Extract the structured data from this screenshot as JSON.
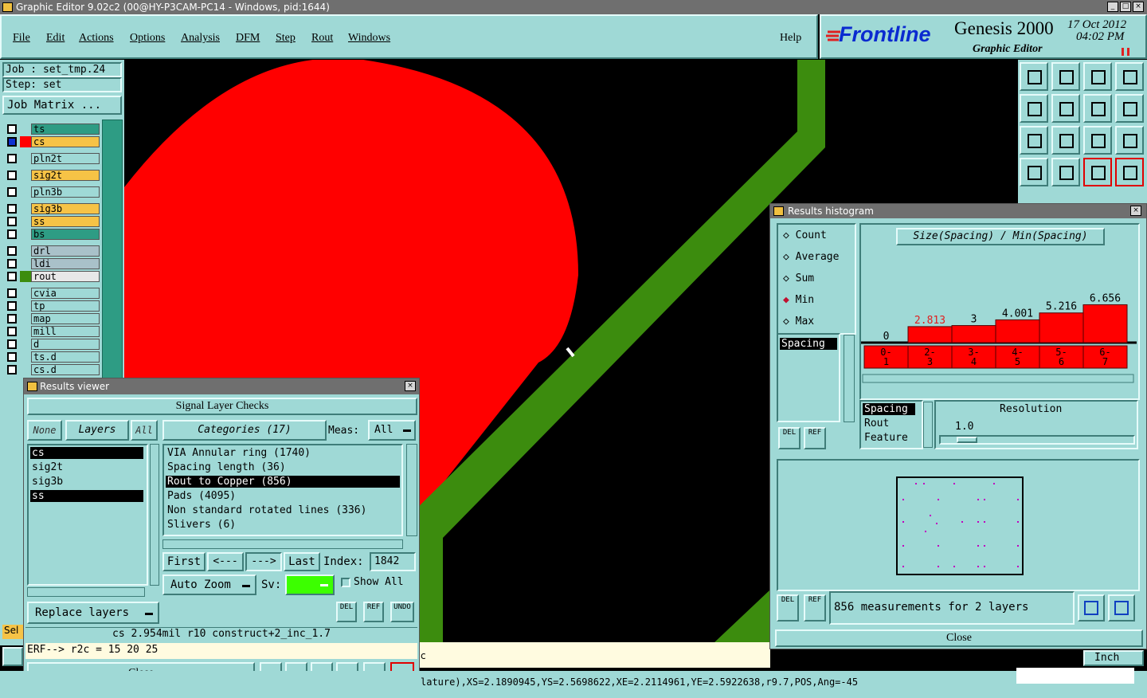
{
  "window": {
    "title": "Graphic Editor 9.02c2 (00@HY-P3CAM-PC14 - Windows, pid:1644)"
  },
  "menu": [
    "File",
    "Edit",
    "Actions",
    "Options",
    "Analysis",
    "DFM",
    "Step",
    "Rout",
    "Windows"
  ],
  "menu_help": "Help",
  "brand": {
    "logo": "Frontline",
    "product": "Genesis 2000",
    "subtitle": "Graphic Editor",
    "date": "17 Oct 2012",
    "time": "04:02 PM"
  },
  "job": {
    "job_label": "Job : set_tmp.24",
    "step_label": "Step: set",
    "matrix_button": "Job Matrix ..."
  },
  "layers": [
    "ts",
    "cs",
    "pln2t",
    "sig2t",
    "pln3b",
    "sig3b",
    "ss",
    "bs",
    "drl",
    "ldi",
    "rout",
    "cvia",
    "tp",
    "map",
    "mill",
    "d",
    "ts.d",
    "cs.d"
  ],
  "colors": {
    "board_red": "#ff0000",
    "trace_green": "#3c8c0e",
    "panel": "#9fd9d6",
    "layer_green": "#2e9c84",
    "layer_orange": "#f6c346",
    "sv_green": "#3cff00"
  },
  "results_viewer": {
    "title": "Results viewer",
    "header": "Signal Layer Checks",
    "filter_none": "None",
    "filter_layers": "Layers",
    "filter_all": "All",
    "categories_btn": "Categories (17)",
    "meas_label": "Meas:",
    "meas_value": "All",
    "layer_list": [
      "cs",
      "sig2t",
      "sig3b",
      "ss"
    ],
    "categories": [
      "VIA Annular ring (1740)",
      "Spacing length (36)",
      "Rout to Copper (856)",
      "Pads (4095)",
      "Non standard rotated lines (336)",
      "Slivers (6)"
    ],
    "nav": {
      "first": "First",
      "prev": "<---",
      "next": "--->",
      "last": "Last",
      "index_label": "Index:",
      "index_value": "1842"
    },
    "auto_zoom": "Auto Zoom",
    "sv_label": "Sv:",
    "show_all": "Show All",
    "replace_layers": "Replace layers",
    "del": "DEL",
    "ref": "REF",
    "undo": "UNDO",
    "status": "cs 2.954mil  r10  construct+2_inc_1.7",
    "erf": "ERF--> r2c = 15 20 25",
    "close": "Close"
  },
  "histogram": {
    "title": "Results histogram",
    "modes": [
      "Count",
      "Average",
      "Sum",
      "Min",
      "Max"
    ],
    "selected_mode": "Min",
    "header": "Size(Spacing) / Min(Spacing)",
    "list_item": "Spacing",
    "group_list": [
      "Spacing",
      "Rout",
      "Feature"
    ],
    "resolution_label": "Resolution",
    "resolution_value": "1.0",
    "summary": "856 measurements for 2 layers",
    "close": "Close",
    "del": "DEL",
    "ref": "REF"
  },
  "chart_data": {
    "type": "bar",
    "categories": [
      "0-\n1",
      "2-\n3",
      "3-\n4",
      "4-\n5",
      "5-\n6",
      "6-\n7"
    ],
    "values": [
      0,
      2.813,
      3,
      4.001,
      5.216,
      6.656
    ],
    "value_labels": [
      "0",
      "2.813",
      "3",
      "4.001",
      "5.216",
      "6.656"
    ],
    "title": "Size(Spacing) / Min(Spacing)",
    "ylim": [
      0,
      7
    ]
  },
  "cmdline": "lature),XS=2.1890945,YS=2.5698622,XE=2.2114961,YE=2.5922638,r9.7,POS,Ang=-45",
  "units": "Inch",
  "sel": "Sel",
  "info_c": "c"
}
